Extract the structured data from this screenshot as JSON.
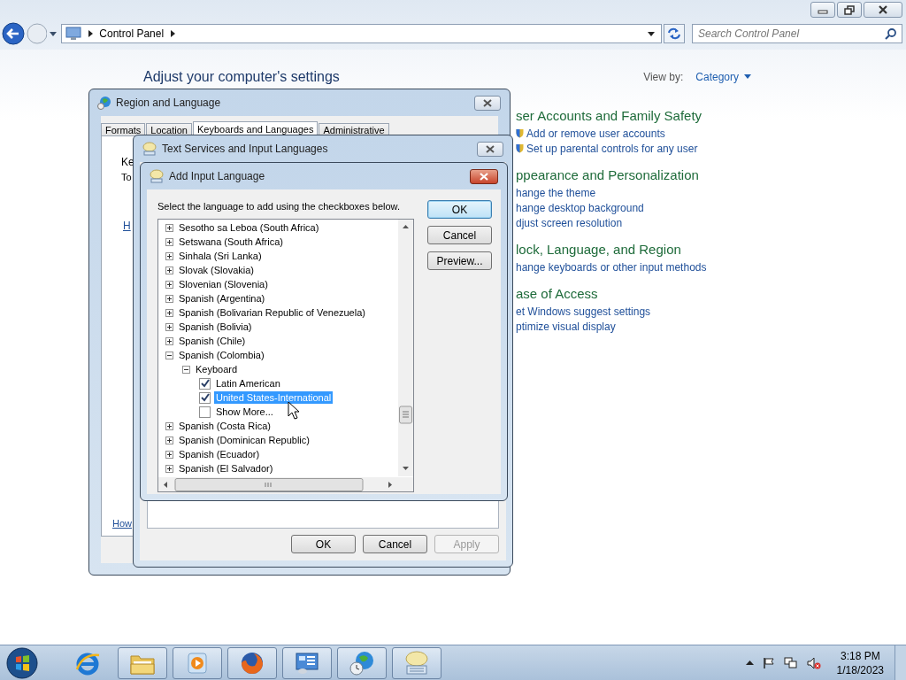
{
  "explorer": {
    "breadcrumb": "Control Panel",
    "search": {
      "placeholder": "Search Control Panel"
    }
  },
  "control_panel": {
    "heading": "Adjust your computer's settings",
    "view_by_label": "View by:",
    "view_by_value": "Category",
    "categories": [
      {
        "title": "ser Accounts and Family Safety",
        "links": [
          {
            "text": "Add or remove user accounts",
            "shield": true
          },
          {
            "text": "Set up parental controls for any user",
            "shield": true
          }
        ]
      },
      {
        "title": "ppearance and Personalization",
        "links": [
          {
            "text": "hange the theme",
            "shield": false
          },
          {
            "text": "hange desktop background",
            "shield": false
          },
          {
            "text": "djust screen resolution",
            "shield": false
          }
        ]
      },
      {
        "title": "lock, Language, and Region",
        "links": [
          {
            "text": "hange keyboards or other input methods",
            "shield": false
          }
        ]
      },
      {
        "title": "ase of Access",
        "links": [
          {
            "text": "et Windows suggest settings",
            "shield": false
          },
          {
            "text": "ptimize visual display",
            "shield": false
          }
        ]
      }
    ]
  },
  "region_window": {
    "title": "Region and Language",
    "tabs": [
      {
        "label": "Formats",
        "selected": false
      },
      {
        "label": "Location",
        "selected": false
      },
      {
        "label": "Keyboards and Languages",
        "selected": true
      },
      {
        "label": "Administrative",
        "selected": false
      }
    ],
    "fragments": [
      "Ke",
      "To"
    ],
    "links": [
      "H",
      "How"
    ]
  },
  "text_services_window": {
    "title": "Text Services and Input Languages",
    "buttons": [
      {
        "label": "OK",
        "disabled": false
      },
      {
        "label": "Cancel",
        "disabled": false
      },
      {
        "label": "Apply",
        "disabled": true
      }
    ]
  },
  "add_language": {
    "title": "Add Input Language",
    "instruction": "Select the language to add using the checkboxes below.",
    "buttons": [
      {
        "label": "OK",
        "default": true
      },
      {
        "label": "Cancel",
        "default": false
      },
      {
        "label": "Preview...",
        "default": false
      }
    ],
    "tree": [
      {
        "label": "Sesotho sa Leboa (South Africa)",
        "expanded": false
      },
      {
        "label": "Setswana (South Africa)",
        "expanded": false
      },
      {
        "label": "Sinhala (Sri Lanka)",
        "expanded": false
      },
      {
        "label": "Slovak (Slovakia)",
        "expanded": false
      },
      {
        "label": "Slovenian (Slovenia)",
        "expanded": false
      },
      {
        "label": "Spanish (Argentina)",
        "expanded": false
      },
      {
        "label": "Spanish (Bolivarian Republic of Venezuela)",
        "expanded": false
      },
      {
        "label": "Spanish (Bolivia)",
        "expanded": false
      },
      {
        "label": "Spanish (Chile)",
        "expanded": false
      },
      {
        "label": "Spanish (Colombia)",
        "expanded": true,
        "children": [
          {
            "label": "Keyboard",
            "expanded": true,
            "children": [
              {
                "label": "Latin American",
                "kind": "option",
                "checked": true,
                "selected": false
              },
              {
                "label": "United States-International",
                "kind": "option",
                "checked": true,
                "selected": true
              },
              {
                "label": "Show More...",
                "kind": "option",
                "checked": false,
                "selected": false
              }
            ]
          }
        ]
      },
      {
        "label": "Spanish (Costa Rica)",
        "expanded": false
      },
      {
        "label": "Spanish (Dominican Republic)",
        "expanded": false
      },
      {
        "label": "Spanish (Ecuador)",
        "expanded": false
      },
      {
        "label": "Spanish (El Salvador)",
        "expanded": false
      }
    ]
  },
  "taskbar": {
    "apps": [
      {
        "kind": "ie",
        "running": false
      },
      {
        "kind": "folder",
        "running": true
      },
      {
        "kind": "media",
        "running": true
      },
      {
        "kind": "firefox",
        "running": true
      },
      {
        "kind": "control",
        "running": true
      },
      {
        "kind": "globe",
        "running": true
      },
      {
        "kind": "keyboard",
        "running": true
      }
    ],
    "time": "3:18 PM",
    "date": "1/18/2023"
  }
}
